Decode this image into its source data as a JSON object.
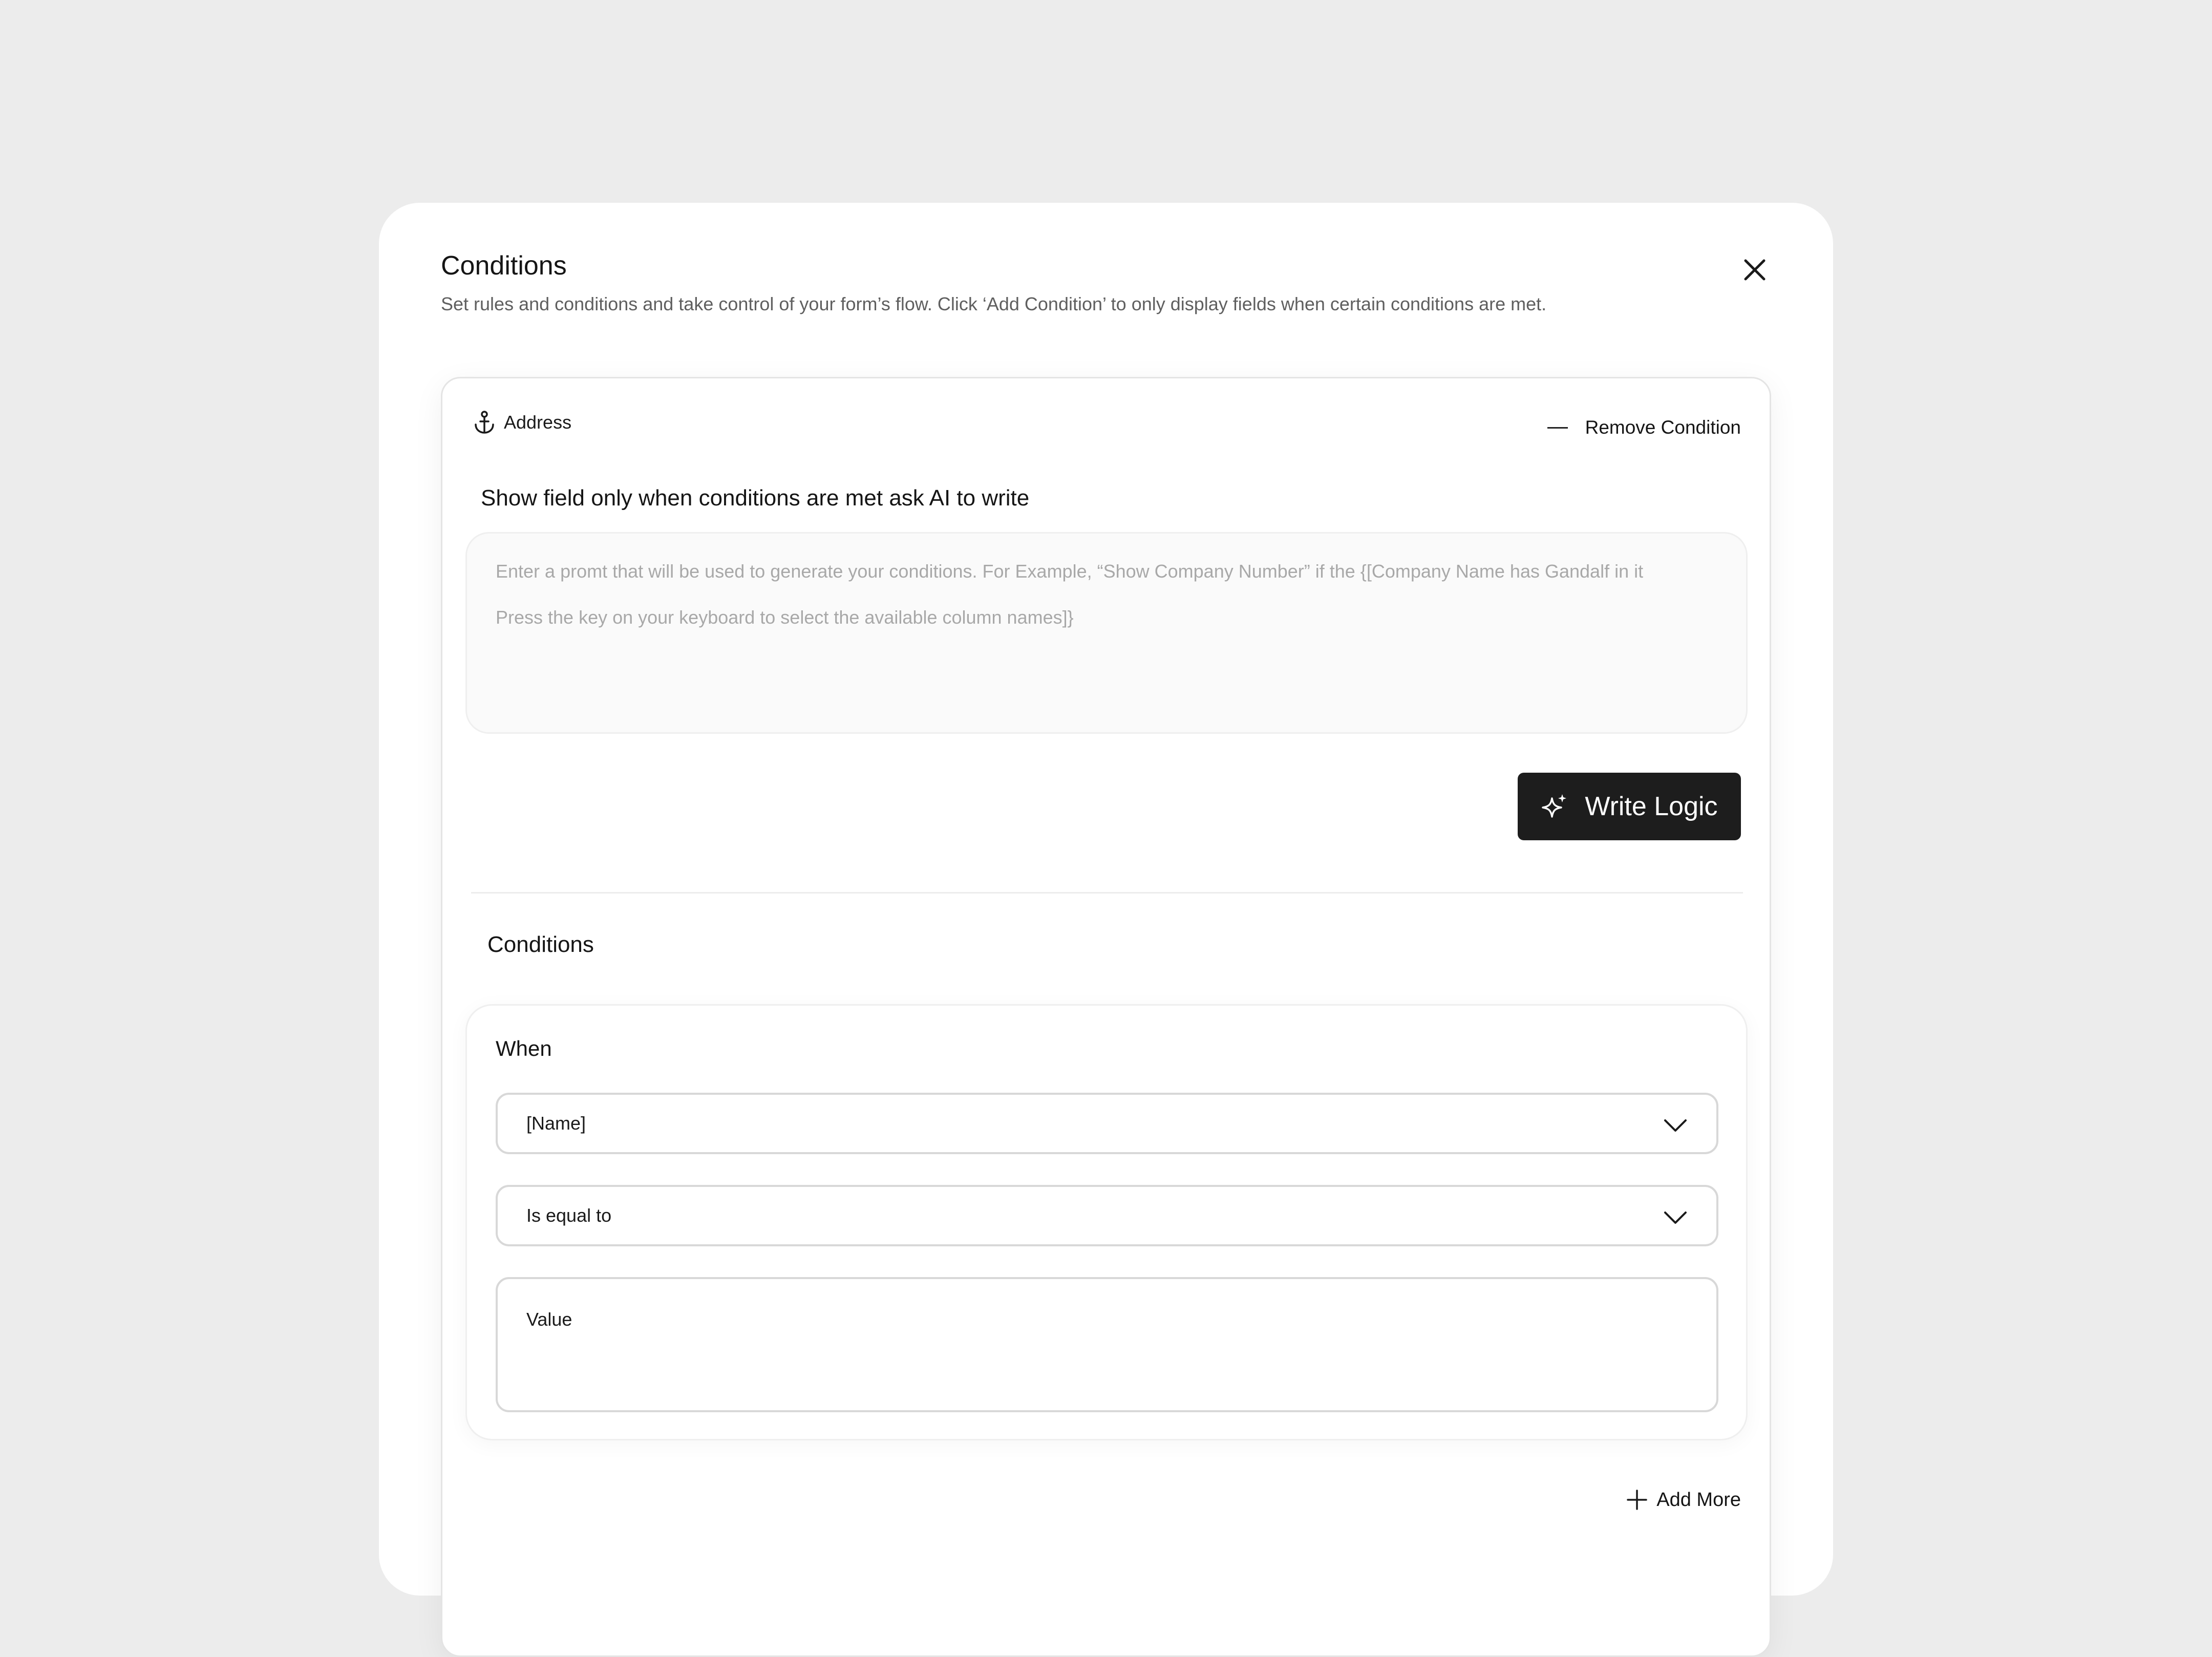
{
  "dialog": {
    "title": "Conditions",
    "subtitle": "Set rules and conditions and take control of your form’s flow. Click ‘Add Condition’ to only display fields when certain conditions are met.",
    "close_icon": "close-icon"
  },
  "condition_card": {
    "field_name": "Address",
    "field_icon": "anchor-icon",
    "remove_label": "Remove Condition",
    "ai_heading": "Show field only when conditions are met ask AI to write",
    "prompt_placeholder_line1": "Enter a promt that will be used to generate your conditions. For Example, “Show Company Number” if the {[Company Name has Gandalf in it",
    "prompt_placeholder_line2": "Press the key on your keyboard to select the available column names]}",
    "write_logic_label": "Write Logic",
    "write_logic_icon": "sparkle-icon",
    "conditions_heading": "Conditions",
    "rule": {
      "when_label": "When",
      "field_select_value": "[Name]",
      "operator_select_value": "Is equal to",
      "value_placeholder": "Value"
    },
    "add_more_label": "Add More",
    "add_more_icon": "plus-icon"
  },
  "colors": {
    "background": "#ececec",
    "surface": "#ffffff",
    "primary_button": "#1d1d1d",
    "placeholder_text": "#a8a8a8"
  }
}
